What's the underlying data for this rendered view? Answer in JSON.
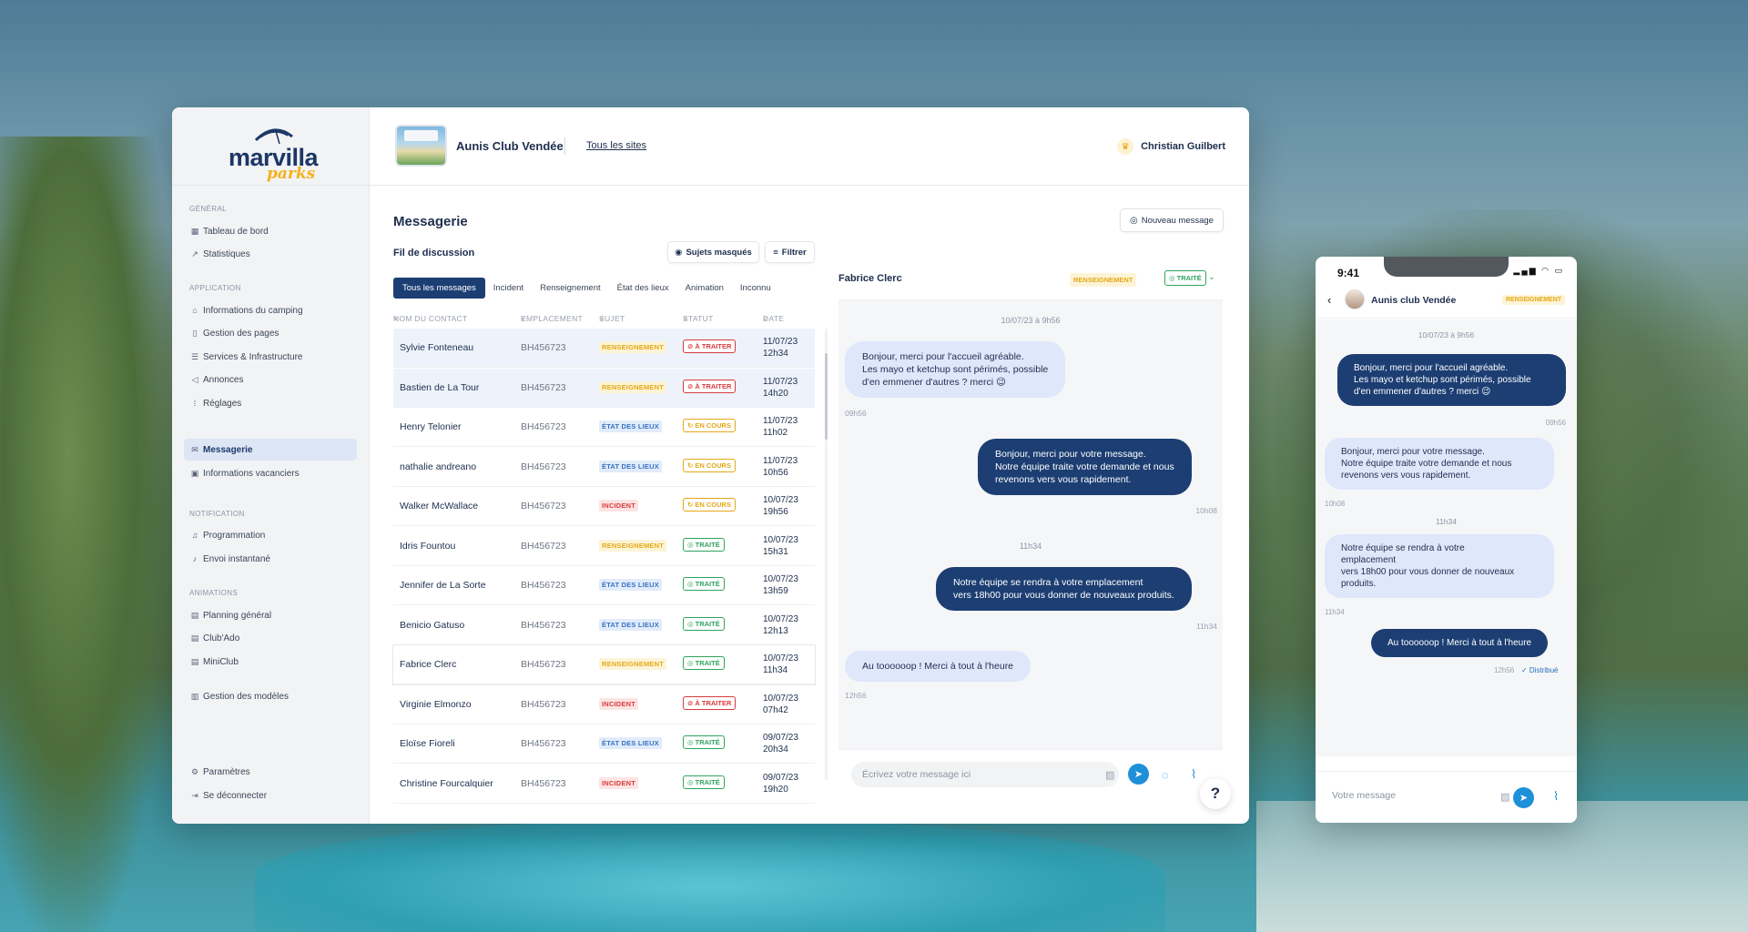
{
  "brand": {
    "logo_main": "marvilla",
    "logo_sub": "parks"
  },
  "sidebar": {
    "sections": [
      {
        "title": "GÉNÉRAL",
        "items": [
          {
            "label": "Tableau de bord",
            "icon": "grid-icon"
          },
          {
            "label": "Statistiques",
            "icon": "trend-icon"
          }
        ]
      },
      {
        "title": "APPLICATION",
        "items": [
          {
            "label": "Informations du camping",
            "icon": "home-icon"
          },
          {
            "label": "Gestion des pages",
            "icon": "page-icon"
          },
          {
            "label": "Services & Infrastructure",
            "icon": "list-icon"
          },
          {
            "label": "Annonces",
            "icon": "megaphone-icon"
          },
          {
            "label": "Réglages",
            "icon": "settings-grid-icon"
          }
        ]
      },
      {
        "title": "",
        "items": [
          {
            "label": "Messagerie",
            "icon": "mail-icon",
            "active": true
          },
          {
            "label": "Informations vacanciers",
            "icon": "id-card-icon"
          }
        ]
      },
      {
        "title": "NOTIFICATION",
        "items": [
          {
            "label": "Programmation",
            "icon": "bell-icon"
          },
          {
            "label": "Envoi instantané",
            "icon": "bell-ring-icon"
          }
        ]
      },
      {
        "title": "ANIMATIONS",
        "items": [
          {
            "label": "Planning général",
            "icon": "calendar-icon"
          },
          {
            "label": "Club'Ado",
            "icon": "calendar-icon"
          },
          {
            "label": "MiniClub",
            "icon": "calendar-icon"
          },
          {
            "label": "Gestion des modèles",
            "icon": "clipboard-icon"
          }
        ]
      }
    ],
    "footer": [
      {
        "label": "Paramètres",
        "icon": "gear-icon"
      },
      {
        "label": "Se déconnecter",
        "icon": "logout-icon"
      }
    ]
  },
  "topbar": {
    "site_name": "Aunis Club Vendée",
    "all_sites": "Tous les sites",
    "user_name": "Christian Guilbert"
  },
  "main": {
    "title": "Messagerie",
    "new_message": "Nouveau message",
    "thread_title": "Fil de discussion",
    "hidden_subjects": "Sujets masqués",
    "filter": "Filtrer",
    "tabs": [
      "Tous les messages",
      "Incident",
      "Renseignement",
      "État des lieux",
      "Animation",
      "Inconnu"
    ],
    "columns": [
      "NOM DU CONTACT",
      "EMPLACEMENT",
      "SUJET",
      "STATUT",
      "DATE"
    ],
    "rows": [
      {
        "name": "Sylvie Fonteneau",
        "location": "BH456723",
        "subject": "RENSEIGNEMENT",
        "subject_type": "rens",
        "status": "À TRAITER",
        "status_type": "todo",
        "date": "11/07/23",
        "time": "12h34"
      },
      {
        "name": "Bastien de La Tour",
        "location": "BH456723",
        "subject": "RENSEIGNEMENT",
        "subject_type": "rens",
        "status": "À TRAITER",
        "status_type": "todo",
        "date": "11/07/23",
        "time": "14h20"
      },
      {
        "name": "Henry Telonier",
        "location": "BH456723",
        "subject": "ÉTAT DES LIEUX",
        "subject_type": "etat",
        "status": "EN COURS",
        "status_type": "cours",
        "date": "11/07/23",
        "time": "11h02"
      },
      {
        "name": "nathalie andreano",
        "location": "BH456723",
        "subject": "ÉTAT DES LIEUX",
        "subject_type": "etat",
        "status": "EN COURS",
        "status_type": "cours",
        "date": "11/07/23",
        "time": "10h56"
      },
      {
        "name": "Walker McWallace",
        "location": "BH456723",
        "subject": "INCIDENT",
        "subject_type": "inc",
        "status": "EN COURS",
        "status_type": "cours",
        "date": "10/07/23",
        "time": "19h56"
      },
      {
        "name": "Idris Fountou",
        "location": "BH456723",
        "subject": "RENSEIGNEMENT",
        "subject_type": "rens",
        "status": "TRAITÉ",
        "status_type": "done",
        "date": "10/07/23",
        "time": "15h31"
      },
      {
        "name": "Jennifer de La Sorte",
        "location": "BH456723",
        "subject": "ÉTAT DES LIEUX",
        "subject_type": "etat",
        "status": "TRAITÉ",
        "status_type": "done",
        "date": "10/07/23",
        "time": "13h59"
      },
      {
        "name": "Benicio Gatuso",
        "location": "BH456723",
        "subject": "ÉTAT DES LIEUX",
        "subject_type": "etat",
        "status": "TRAITÉ",
        "status_type": "done",
        "date": "10/07/23",
        "time": "12h13"
      },
      {
        "name": "Fabrice Clerc",
        "location": "BH456723",
        "subject": "RENSEIGNEMENT",
        "subject_type": "rens",
        "status": "TRAITÉ",
        "status_type": "done",
        "date": "10/07/23",
        "time": "11h34"
      },
      {
        "name": "Virginie Elmonzo",
        "location": "BH456723",
        "subject": "INCIDENT",
        "subject_type": "inc",
        "status": "À TRAITER",
        "status_type": "todo",
        "date": "10/07/23",
        "time": "07h42"
      },
      {
        "name": "Eloïse Fioreli",
        "location": "BH456723",
        "subject": "ÉTAT DES LIEUX",
        "subject_type": "etat",
        "status": "TRAITÉ",
        "status_type": "done",
        "date": "09/07/23",
        "time": "20h34"
      },
      {
        "name": "Christine Fourcalquier",
        "location": "BH456723",
        "subject": "INCIDENT",
        "subject_type": "inc",
        "status": "TRAITÉ",
        "status_type": "done",
        "date": "09/07/23",
        "time": "19h20"
      }
    ]
  },
  "conversation": {
    "contact": "Fabrice Clerc",
    "subject": "RENSEIGNEMENT",
    "status": "TRAITÉ",
    "date_header": "10/07/23 à 9h56",
    "messages": [
      {
        "dir": "in",
        "text": "Bonjour, merci pour l'accueil agréable.\nLes mayo et ketchup sont périmés, possible\nd'en emmener d'autres ? merci 😉",
        "time": "09h56"
      },
      {
        "dir": "out",
        "text": "Bonjour, merci pour votre message.\nNotre équipe traite votre demande et nous\nrevenons vers vous rapidement.",
        "time": "10h08"
      },
      {
        "dir": "out",
        "text": "Notre équipe se rendra à votre emplacement\nvers 18h00 pour vous donner de nouveaux produits.",
        "time": "11h34"
      },
      {
        "dir": "in",
        "text": "Au toooooop ! Merci à tout à l'heure",
        "time": "12h56"
      }
    ],
    "separator": "11h34",
    "placeholder": "Écrivez votre message ici"
  },
  "phone": {
    "clock": "9:41",
    "contact": "Aunis club Vendée",
    "tag": "RENSEIGNEMENT",
    "date_header": "10/07/23 à 9h56",
    "messages": [
      {
        "dir": "out",
        "text": "Bonjour, merci pour l'accueil agréable.\nLes mayo et ketchup sont périmés, possible\nd'en emmener d'autres ? merci 😉",
        "time": "09h56"
      },
      {
        "dir": "in",
        "text": "Bonjour, merci pour votre message.\nNotre équipe traite votre demande et nous\nrevenons vers vous rapidement.",
        "time": "10h08"
      },
      {
        "dir": "in",
        "text": "Notre équipe se rendra à votre\nemplacement\nvers 18h00 pour vous donner de nouveaux\nproduits.",
        "time": "11h34"
      },
      {
        "dir": "out",
        "text": "Au toooooop ! Merci à tout à l'heure",
        "time": "12h56"
      }
    ],
    "separator": "11h34",
    "delivered": "✓ Distribué",
    "placeholder": "Votre message"
  },
  "help_label": "?",
  "colors": {
    "navy": "#1c3e72",
    "accent_blue": "#1e90d9",
    "rens_yellow": "#e4a817",
    "etat_blue": "#3873c4",
    "incident_red": "#d83b3b",
    "done_green": "#2fa35e"
  }
}
